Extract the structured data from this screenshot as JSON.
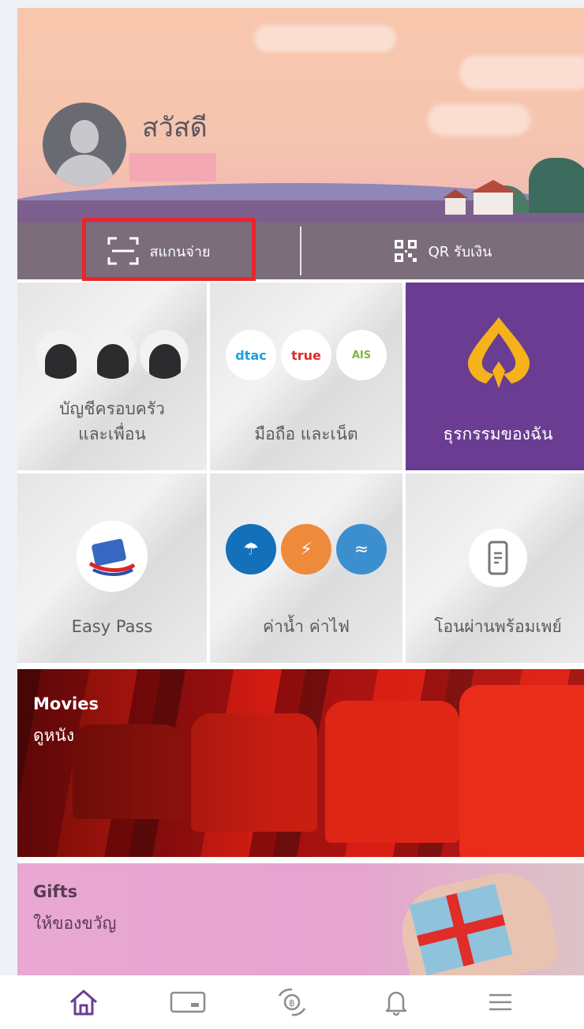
{
  "header": {
    "greeting": "สวัสดี"
  },
  "actions": {
    "scan_pay": "สแกนจ่าย",
    "qr_receive": "QR รับเงิน"
  },
  "tiles": [
    {
      "label_line1": "บัญชีครอบครัว",
      "label_line2": "และเพื่อน"
    },
    {
      "label_line1": "มือถือ และเน็ต",
      "label_line2": ""
    },
    {
      "label_line1": "ธุรกรรมของฉัน",
      "label_line2": ""
    },
    {
      "label_line1": "Easy Pass",
      "label_line2": ""
    },
    {
      "label_line1": "ค่าน้ำ ค่าไฟ",
      "label_line2": ""
    },
    {
      "label_line1": "โอนผ่านพร้อมเพย์",
      "label_line2": ""
    }
  ],
  "brands": {
    "dtac": "dtac",
    "true": "true",
    "ais": "AIS"
  },
  "banners": {
    "movies_title": "Movies",
    "movies_sub": "ดูหนัง",
    "gifts_title": "Gifts",
    "gifts_sub": "ให้ของขวัญ"
  },
  "tabbar": [
    "home-icon",
    "card-icon",
    "rewards-icon",
    "bell-icon",
    "menu-icon"
  ],
  "colors": {
    "accent": "#6a3d93",
    "highlight": "#e8262c",
    "actionbar": "#7b6d7a"
  }
}
